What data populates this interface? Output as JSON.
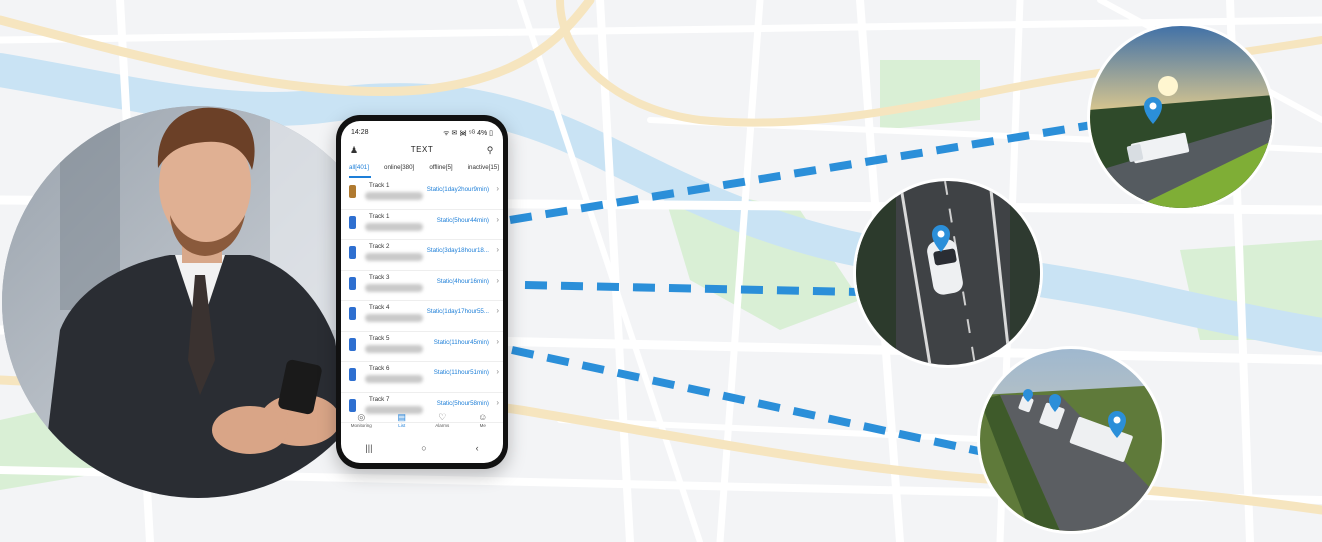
{
  "phone": {
    "status": {
      "time": "14:28",
      "icons": "ᯤ ✉ ᯼ ⁵ᴳ 4% ▯"
    },
    "header": {
      "title": "TEXT",
      "left_icon": "user-icon",
      "right_icon": "search-icon"
    },
    "filters": [
      {
        "label": "all[401]"
      },
      {
        "label": "online[380]"
      },
      {
        "label": "offline[5]"
      },
      {
        "label": "inactive[15]"
      }
    ],
    "tracks": [
      {
        "name": "Track 1",
        "status": "Static(1day2hour9min)",
        "icon": "battery-icon"
      },
      {
        "name": "Track 1",
        "status": "Static(5hour44min)",
        "icon": "car-icon"
      },
      {
        "name": "Track 2",
        "status": "Static(3day18hour18...",
        "icon": "car-icon"
      },
      {
        "name": "Track 3",
        "status": "Static(4hour16min)",
        "icon": "car-icon"
      },
      {
        "name": "Track 4",
        "status": "Static(1day17hour55...",
        "icon": "car-icon"
      },
      {
        "name": "Track 5",
        "status": "Static(11hour45min)",
        "icon": "car-icon"
      },
      {
        "name": "Track 6",
        "status": "Static(11hour51min)",
        "icon": "car-icon"
      },
      {
        "name": "Track 7",
        "status": "Static(5hour58min)",
        "icon": "car-icon"
      }
    ],
    "bottom_nav": [
      {
        "label": "Monitoring",
        "icon": "fingerprint-icon"
      },
      {
        "label": "List",
        "icon": "list-icon"
      },
      {
        "label": "Alarms",
        "icon": "bell-icon"
      },
      {
        "label": "Me",
        "icon": "person-icon"
      }
    ],
    "system_nav": [
      "|||",
      "○",
      "‹"
    ]
  },
  "colors": {
    "accent": "#1e7fd8",
    "route": "#2b8fd9",
    "map_bg": "#f3f4f6",
    "road": "#ffffff",
    "water": "#c9e3f4",
    "park": "#d9efd5",
    "major_road": "#f6e5bf"
  }
}
